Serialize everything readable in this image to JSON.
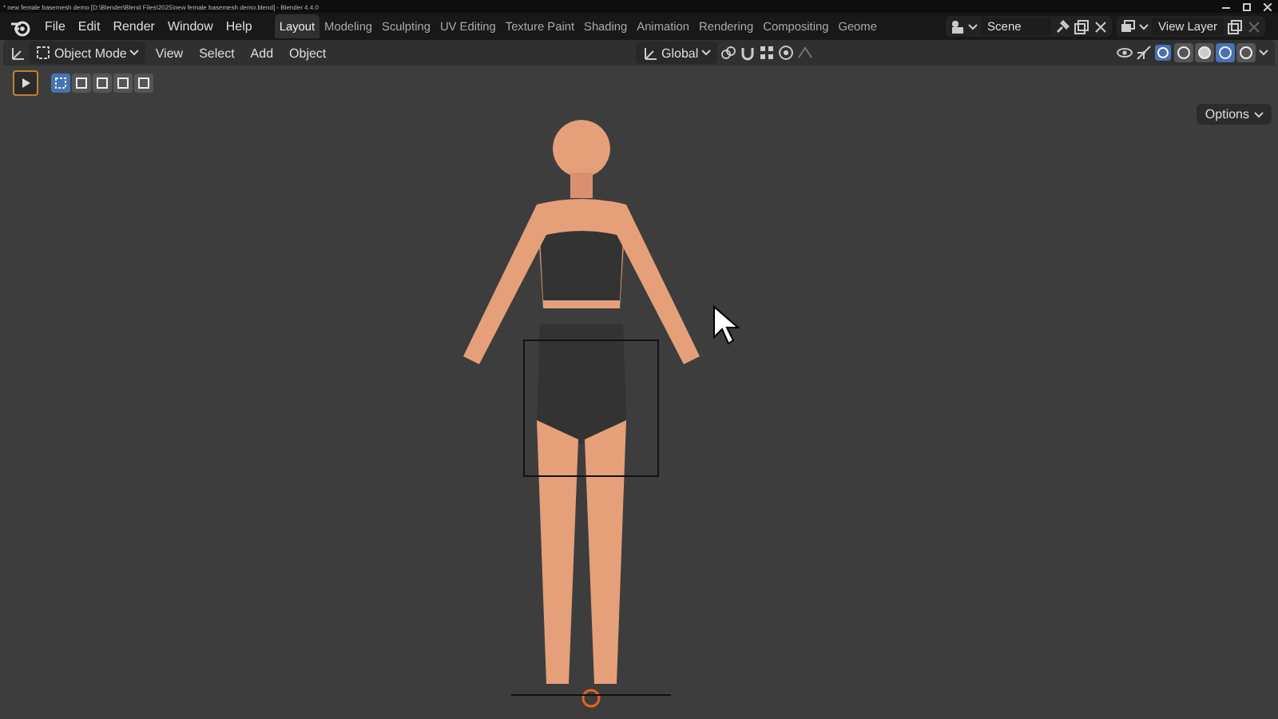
{
  "window": {
    "title": "* new female basemesh demo [D:\\Blender\\Blend Files\\2025\\new female basemesh demo.blend] - Blender 4.4.0"
  },
  "menu": [
    "File",
    "Edit",
    "Render",
    "Window",
    "Help"
  ],
  "workspaces": [
    {
      "label": "Layout",
      "selected": true
    },
    {
      "label": "Modeling",
      "selected": false
    },
    {
      "label": "Sculpting",
      "selected": false
    },
    {
      "label": "UV Editing",
      "selected": false
    },
    {
      "label": "Texture Paint",
      "selected": false
    },
    {
      "label": "Shading",
      "selected": false
    },
    {
      "label": "Animation",
      "selected": false
    },
    {
      "label": "Rendering",
      "selected": false
    },
    {
      "label": "Compositing",
      "selected": false
    },
    {
      "label": "Geome",
      "selected": false
    }
  ],
  "scene": {
    "name": "Scene"
  },
  "view_layer": {
    "name": "View Layer"
  },
  "header": {
    "mode": "Object Mode",
    "menus": [
      "View",
      "Select",
      "Add",
      "Object"
    ],
    "orientation": "Global"
  },
  "select_modes": [
    {
      "selected": true
    },
    {
      "selected": false
    },
    {
      "selected": false
    },
    {
      "selected": false
    },
    {
      "selected": false
    }
  ],
  "shading_modes": [
    {
      "selected": false
    },
    {
      "selected": false
    },
    {
      "selected": true
    },
    {
      "selected": false
    }
  ],
  "options_button": "Options"
}
